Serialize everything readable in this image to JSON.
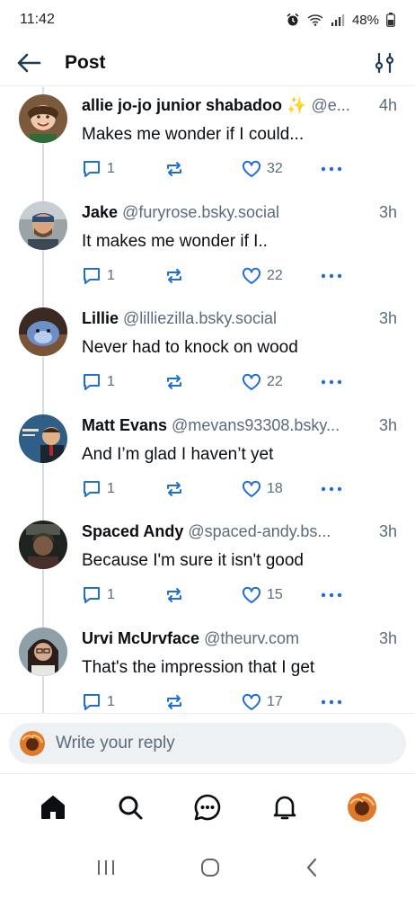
{
  "status_bar": {
    "time": "11:42",
    "battery": "48%"
  },
  "header": {
    "title": "Post"
  },
  "posts": [
    {
      "display_name": "allie jo-jo junior shabadoo ✨",
      "handle": "@e...",
      "time": "4h",
      "text": "Makes me wonder if I could...",
      "replies": "1",
      "likes": "32"
    },
    {
      "display_name": "Jake",
      "handle": "@furyrose.bsky.social",
      "time": "3h",
      "text": "It makes me wonder if I..",
      "replies": "1",
      "likes": "22"
    },
    {
      "display_name": "Lillie",
      "handle": "@lilliezilla.bsky.social",
      "time": "3h",
      "text": "Never had to knock on wood",
      "replies": "1",
      "likes": "22"
    },
    {
      "display_name": "Matt Evans",
      "handle": "@mevans93308.bsky...",
      "time": "3h",
      "text": "And I’m glad I haven’t yet",
      "replies": "1",
      "likes": "18"
    },
    {
      "display_name": "Spaced Andy",
      "handle": "@spaced-andy.bs...",
      "time": "3h",
      "text": "Because I'm sure it isn't good",
      "replies": "1",
      "likes": "15"
    },
    {
      "display_name": "Urvi McUrvface",
      "handle": "@theurv.com",
      "time": "3h",
      "text": "That's the impression that I get",
      "replies": "1",
      "likes": "17"
    }
  ],
  "reply_bar": {
    "placeholder": "Write your reply"
  },
  "bottom_nav": [
    "home-icon",
    "search-icon",
    "chat-icon",
    "notifications-icon",
    "profile-avatar"
  ],
  "colors": {
    "accent": "#1083fe",
    "muted": "#5b6b7c",
    "thread_line": "#d4dbe2",
    "input_bg": "#eef1f4"
  }
}
